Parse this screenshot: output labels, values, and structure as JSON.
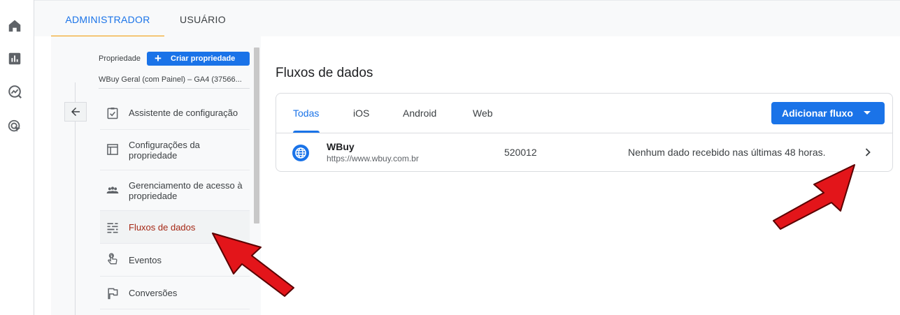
{
  "rail": {
    "icons": [
      "home-icon",
      "reports-icon",
      "explore-icon",
      "advertising-icon"
    ]
  },
  "top_tabs": {
    "admin": "ADMINISTRADOR",
    "user": "USUÁRIO"
  },
  "property": {
    "label": "Propriedade",
    "create_button": "Criar propriedade",
    "name": "WBuy Geral (com Painel) – GA4 (37566..."
  },
  "menu": {
    "items": [
      {
        "label": "Assistente de configuração",
        "icon": "checklist-icon"
      },
      {
        "label": "Configurações da propriedade",
        "icon": "layout-icon"
      },
      {
        "label": "Gerenciamento de acesso à propriedade",
        "icon": "people-icon"
      },
      {
        "label": "Fluxos de dados",
        "icon": "data-streams-icon"
      },
      {
        "label": "Eventos",
        "icon": "touch-icon"
      },
      {
        "label": "Conversões",
        "icon": "flag-icon"
      }
    ]
  },
  "main": {
    "title": "Fluxos de dados",
    "tabs": [
      "Todas",
      "iOS",
      "Android",
      "Web"
    ],
    "add_button": "Adicionar fluxo",
    "stream": {
      "name": "WBuy",
      "url": "https://www.wbuy.com.br",
      "id": "520012",
      "status": "Nenhum dado recebido nas últimas 48 horas."
    }
  },
  "colors": {
    "accent": "#1a73e8",
    "tab_indicator": "#f29900",
    "selected_text": "#a52714",
    "annotation_arrow": "#e3151a"
  }
}
